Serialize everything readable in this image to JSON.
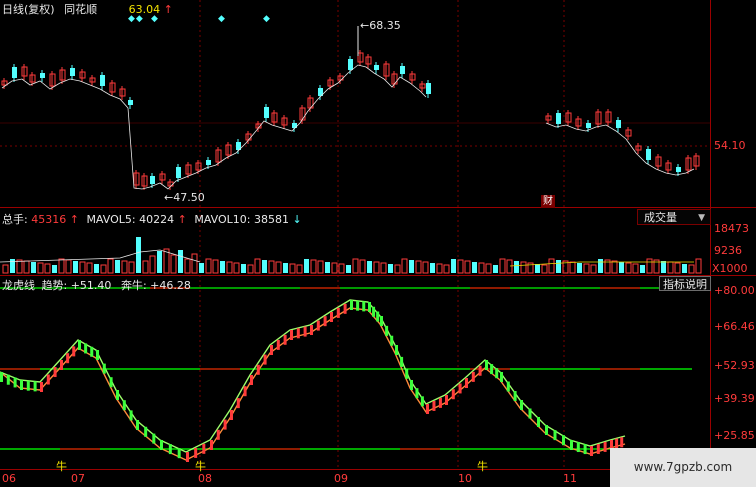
{
  "header": {
    "period": "日线(复权)",
    "stock_name": "同花顺",
    "price": "63.04",
    "up_arrow": "↑"
  },
  "price_panel": {
    "high_label": "68.35",
    "low_label": "47.50",
    "axis_label": "54.10",
    "finance_marker": "财"
  },
  "volume_panel": {
    "total_label": "总手",
    "total_value": "45316",
    "mavol5_label": "MAVOL5",
    "mavol5_value": "40224",
    "mavol10_label": "MAVOL10",
    "mavol10_value": "38581",
    "up_arrow": "↑",
    "down_arrow": "↓",
    "selector_value": "成交量",
    "axis_top": "18473",
    "axis_mid": "9236",
    "axis_unit": "X1000"
  },
  "indicator_panel": {
    "name": "龙虎线",
    "trend_label": "趋势",
    "trend_value": "+51.40",
    "bull_label": "奔牛",
    "bull_value": "+46.28",
    "help_button": "指标说明",
    "axis": [
      "+80.00",
      "+66.46",
      "+52.93",
      "+39.39",
      "+25.85"
    ],
    "bull_markers": [
      "牛",
      "牛",
      "牛"
    ]
  },
  "time_axis": [
    "06",
    "07",
    "08",
    "09",
    "10",
    "11"
  ],
  "watermark": "www.7gpzb.com",
  "colors": {
    "up": "#ff3b3b",
    "down": "#54ffff",
    "grid": "#7a0000",
    "trend_line": "#9cff6a",
    "bull_line": "#ff8a3a",
    "level_green": "#00e000"
  }
}
